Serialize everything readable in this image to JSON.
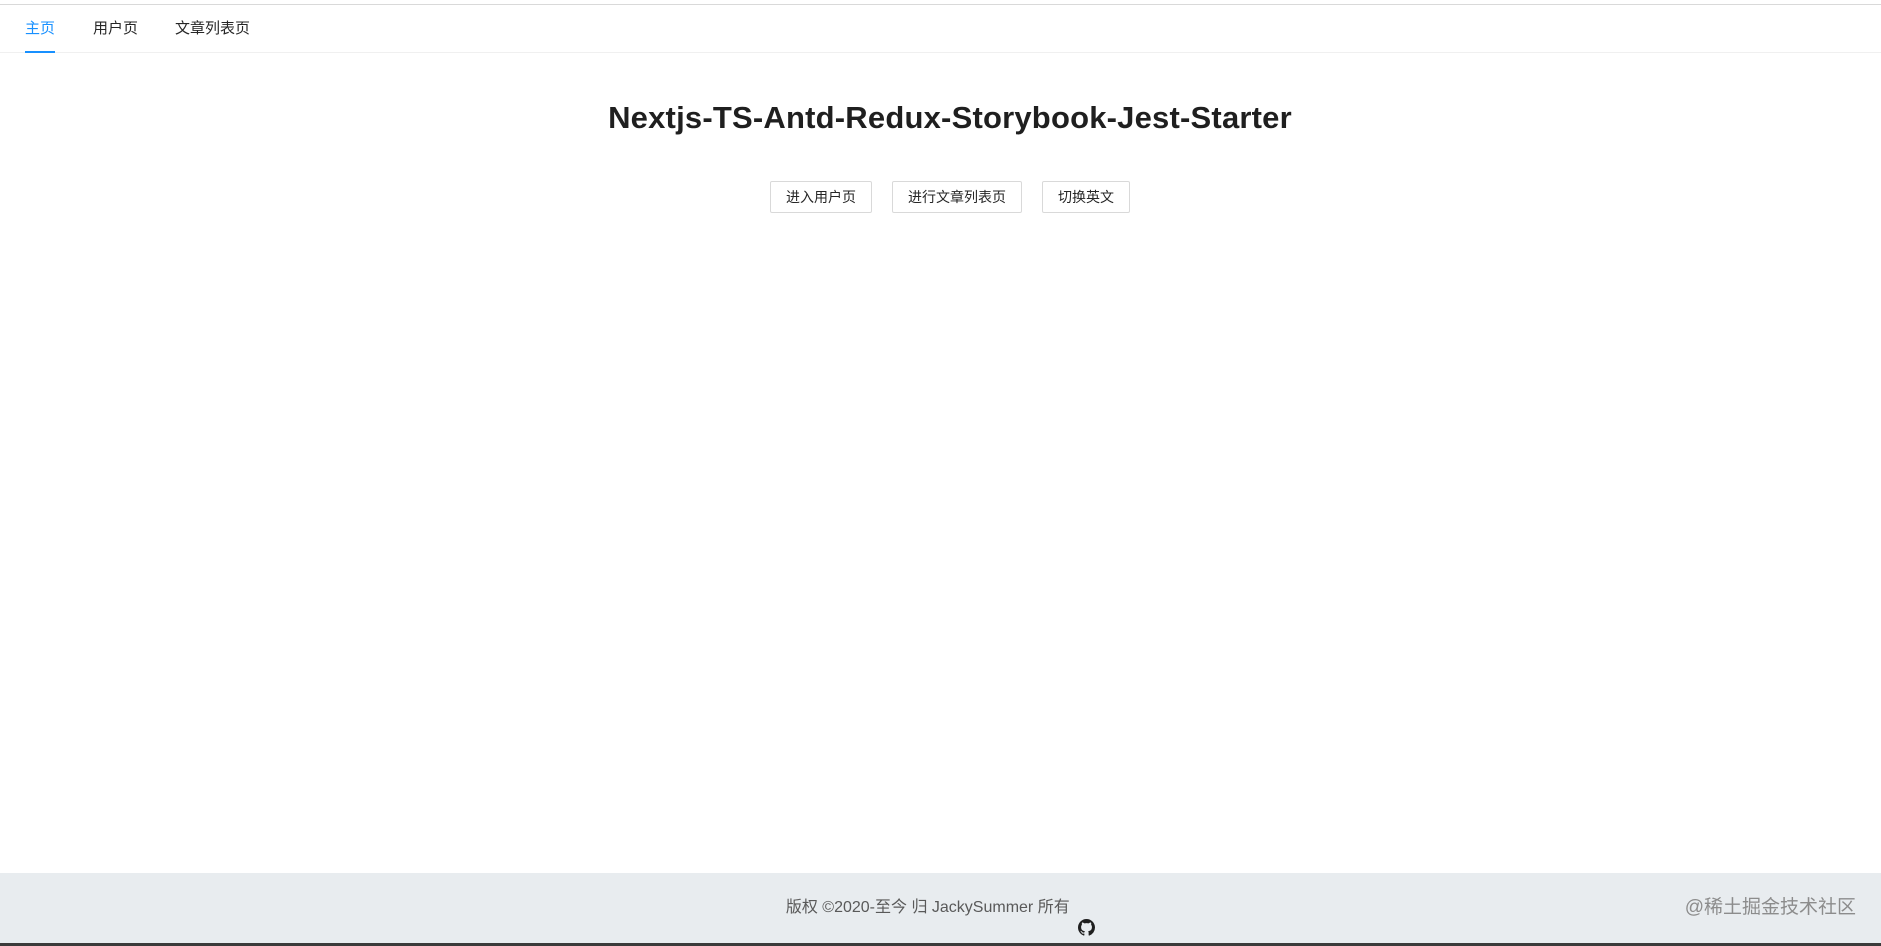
{
  "nav": {
    "items": [
      {
        "label": "主页",
        "active": true
      },
      {
        "label": "用户页",
        "active": false
      },
      {
        "label": "文章列表页",
        "active": false
      }
    ],
    "active_color": "#1890ff"
  },
  "main": {
    "title": "Nextjs-TS-Antd-Redux-Storybook-Jest-Starter",
    "buttons": [
      {
        "label": "进入用户页"
      },
      {
        "label": "进行文章列表页"
      },
      {
        "label": "切换英文"
      }
    ]
  },
  "footer": {
    "copyright": "版权 ©2020-至今 归 JackySummer 所有",
    "icon": "github-icon",
    "background": "#e8ecef"
  },
  "watermark": {
    "text": "@稀土掘金技术社区"
  }
}
